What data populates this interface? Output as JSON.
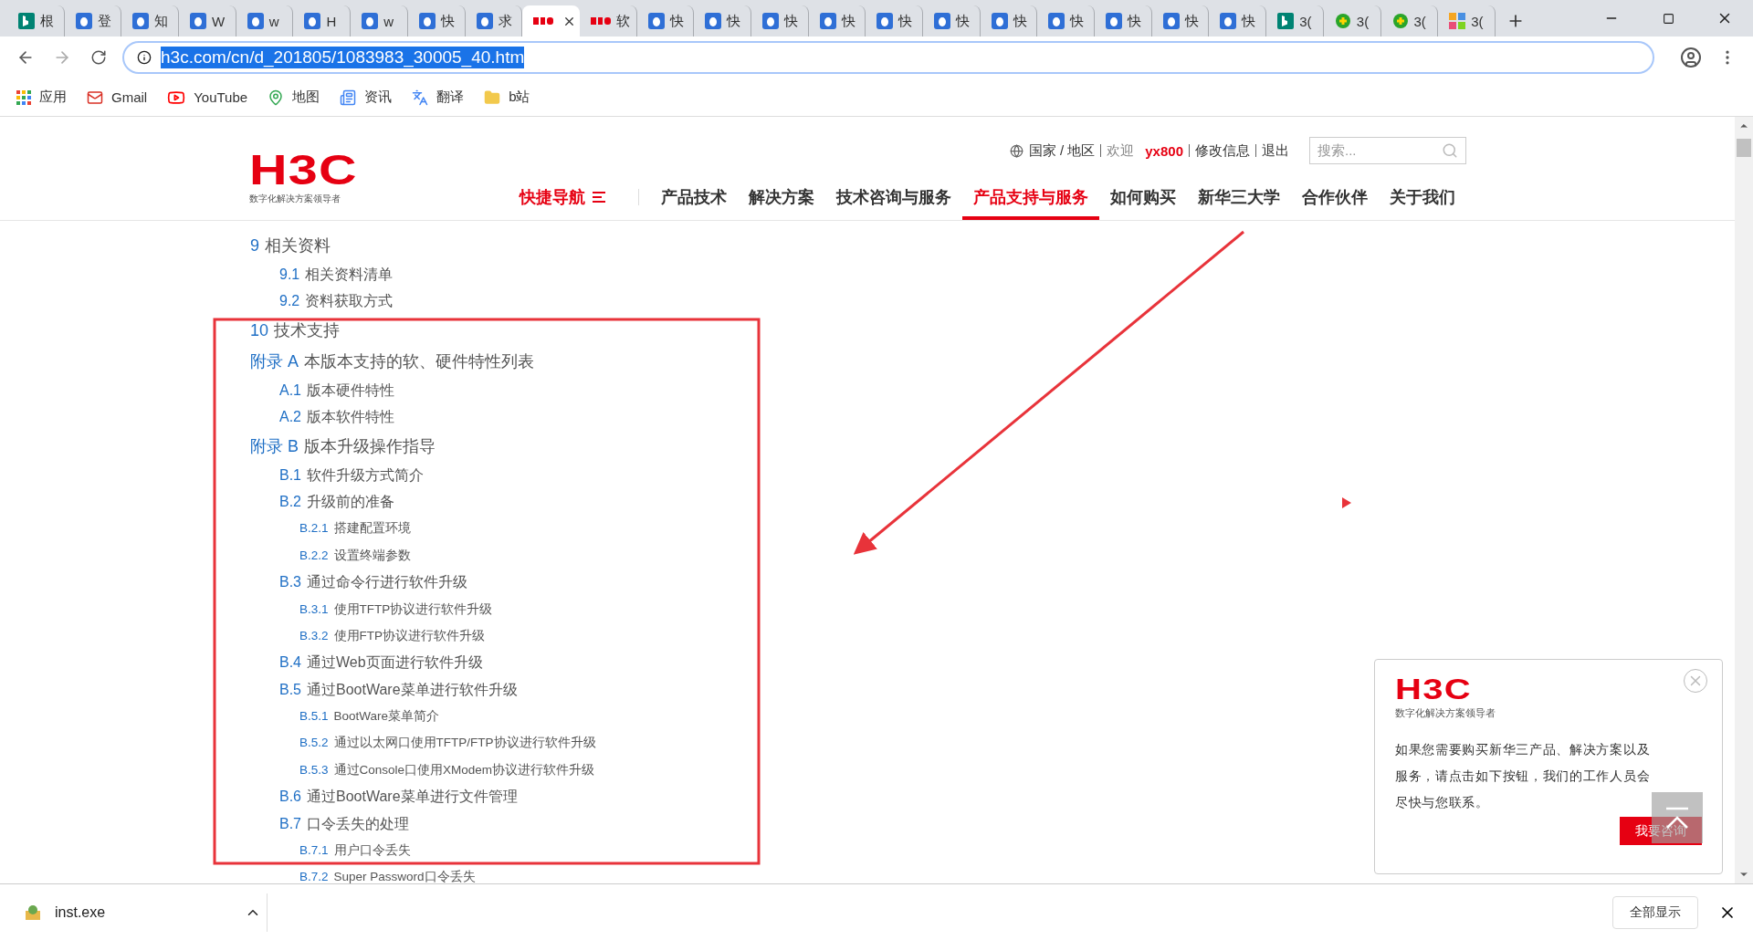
{
  "browser": {
    "tabs": [
      {
        "label": "根",
        "kind": "bing",
        "selected": false
      },
      {
        "label": "登",
        "kind": "doc",
        "selected": false
      },
      {
        "label": "知",
        "kind": "doc",
        "selected": false
      },
      {
        "label": "W",
        "kind": "doc",
        "selected": false
      },
      {
        "label": "w",
        "kind": "doc",
        "selected": false
      },
      {
        "label": "H",
        "kind": "doc",
        "selected": false
      },
      {
        "label": "w",
        "kind": "doc",
        "selected": false
      },
      {
        "label": "快",
        "kind": "doc",
        "selected": false
      },
      {
        "label": "求",
        "kind": "doc",
        "selected": false
      },
      {
        "kind": "h3c",
        "selected": true
      },
      {
        "label": "软",
        "kind": "h3c",
        "selected": false
      },
      {
        "label": "快",
        "kind": "doc",
        "selected": false
      },
      {
        "label": "快",
        "kind": "doc",
        "selected": false
      },
      {
        "label": "快",
        "kind": "doc",
        "selected": false
      },
      {
        "label": "快",
        "kind": "doc",
        "selected": false
      },
      {
        "label": "快",
        "kind": "doc",
        "selected": false
      },
      {
        "label": "快",
        "kind": "doc",
        "selected": false
      },
      {
        "label": "快",
        "kind": "doc",
        "selected": false
      },
      {
        "label": "快",
        "kind": "doc",
        "selected": false
      },
      {
        "label": "快",
        "kind": "doc",
        "selected": false
      },
      {
        "label": "快",
        "kind": "doc",
        "selected": false
      },
      {
        "label": "快",
        "kind": "doc",
        "selected": false
      },
      {
        "label": "3(",
        "kind": "bing",
        "selected": false
      },
      {
        "label": "3(",
        "kind": "green",
        "selected": false
      },
      {
        "label": "3(",
        "kind": "green",
        "selected": false
      },
      {
        "label": "3(",
        "kind": "grid",
        "selected": false
      }
    ],
    "address_bar": {
      "url": "h3c.com/cn/d_201805/1083983_30005_40.htm",
      "text_selected": true
    },
    "bookmarks": [
      {
        "label": "应用",
        "kind": "apps"
      },
      {
        "label": "Gmail",
        "kind": "gmail"
      },
      {
        "label": "YouTube",
        "kind": "youtube"
      },
      {
        "label": "地图",
        "kind": "maps"
      },
      {
        "label": "资讯",
        "kind": "news"
      },
      {
        "label": "翻译",
        "kind": "translate"
      },
      {
        "label": "b站",
        "kind": "folder"
      }
    ]
  },
  "header": {
    "logo": {
      "text": "H3C",
      "tagline": "数字化解决方案领导者"
    },
    "top_links": {
      "region": "国家 / 地区",
      "welcome": "欢迎",
      "user": "yx800",
      "links": [
        "修改信息",
        "退出"
      ]
    },
    "search": {
      "placeholder": "搜索..."
    },
    "nav": [
      {
        "label": "快捷导航",
        "kind": "quick",
        "selected": false
      },
      {
        "label": "产品技术",
        "kind": "link",
        "selected": false
      },
      {
        "label": "解决方案",
        "kind": "link",
        "selected": false
      },
      {
        "label": "技术咨询与服务",
        "kind": "link",
        "selected": false
      },
      {
        "label": "产品支持与服务",
        "kind": "link",
        "selected": true
      },
      {
        "label": "如何购买",
        "kind": "link",
        "selected": false
      },
      {
        "label": "新华三大学",
        "kind": "link",
        "selected": false
      },
      {
        "label": "合作伙伴",
        "kind": "link",
        "selected": false
      },
      {
        "label": "关于我们",
        "kind": "link",
        "selected": false
      }
    ]
  },
  "toc": [
    {
      "num": "9",
      "title": "相关资料",
      "children": [
        {
          "num": "9.1",
          "title": "相关资料清单"
        },
        {
          "num": "9.2",
          "title": "资料获取方式"
        }
      ]
    },
    {
      "num": "10",
      "title": "技术支持"
    },
    {
      "num": "附录 A",
      "title": "本版本支持的软、硬件特性列表",
      "children": [
        {
          "num": "A.1",
          "title": "版本硬件特性"
        },
        {
          "num": "A.2",
          "title": "版本软件特性"
        }
      ]
    },
    {
      "num": "附录 B",
      "title": "版本升级操作指导",
      "children": [
        {
          "num": "B.1",
          "title": "软件升级方式简介"
        },
        {
          "num": "B.2",
          "title": "升级前的准备",
          "children": [
            {
              "num": "B.2.1",
              "title": "搭建配置环境"
            },
            {
              "num": "B.2.2",
              "title": "设置终端参数"
            }
          ]
        },
        {
          "num": "B.3",
          "title": "通过命令行进行软件升级",
          "children": [
            {
              "num": "B.3.1",
              "title": "使用TFTP协议进行软件升级"
            },
            {
              "num": "B.3.2",
              "title": "使用FTP协议进行软件升级"
            }
          ]
        },
        {
          "num": "B.4",
          "title": "通过Web页面进行软件升级"
        },
        {
          "num": "B.5",
          "title": "通过BootWare菜单进行软件升级",
          "children": [
            {
              "num": "B.5.1",
              "title": "BootWare菜单简介"
            },
            {
              "num": "B.5.2",
              "title": "通过以太网口使用TFTP/FTP协议进行软件升级"
            },
            {
              "num": "B.5.3",
              "title": "通过Console口使用XModem协议进行软件升级"
            }
          ]
        },
        {
          "num": "B.6",
          "title": "通过BootWare菜单进行文件管理"
        },
        {
          "num": "B.7",
          "title": "口令丢失的处理",
          "children": [
            {
              "num": "B.7.1",
              "title": "用户口令丢失"
            },
            {
              "num": "B.7.2",
              "title": "Super Password口令丢失"
            }
          ]
        }
      ]
    }
  ],
  "popup": {
    "logo": {
      "text": "H3C",
      "tagline": "数字化解决方案领导者"
    },
    "message": "如果您需要购买新华三产品、解决方案以及服务，请点击如下按钮，我们的工作人员会尽快与您联系。",
    "button": "我要咨询"
  },
  "downloads": {
    "file": "inst.exe",
    "show_all": "全部显示"
  }
}
